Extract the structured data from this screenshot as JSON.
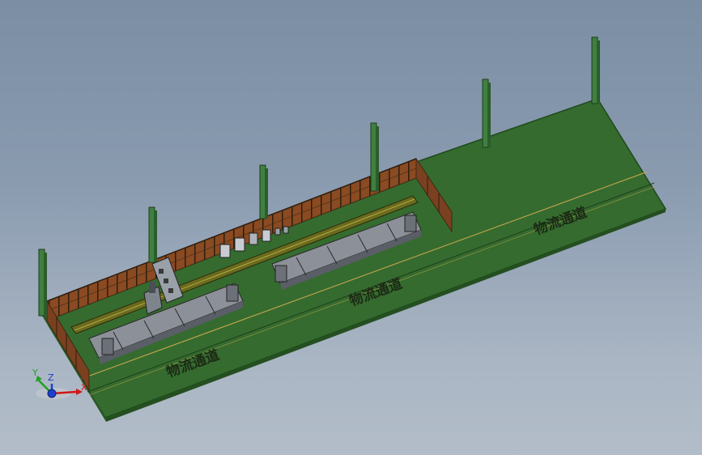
{
  "scene": {
    "lane_labels": [
      "物流通道",
      "物流通道",
      "物流通道"
    ],
    "colors": {
      "floor": "#356b2f",
      "floor_edge": "#1f4a1c",
      "fence": "#8a4a22",
      "fence_frame": "#3d2a14",
      "column": "#3f8040",
      "rail": "#6b6b1e",
      "machine": "#8c9098",
      "stripe": "#b8a24a"
    },
    "triad": {
      "x_label": "X",
      "y_label": "Y",
      "z_label": "Z",
      "x_color": "#d01818",
      "y_color": "#20a020",
      "z_color": "#1d3fd0"
    }
  }
}
